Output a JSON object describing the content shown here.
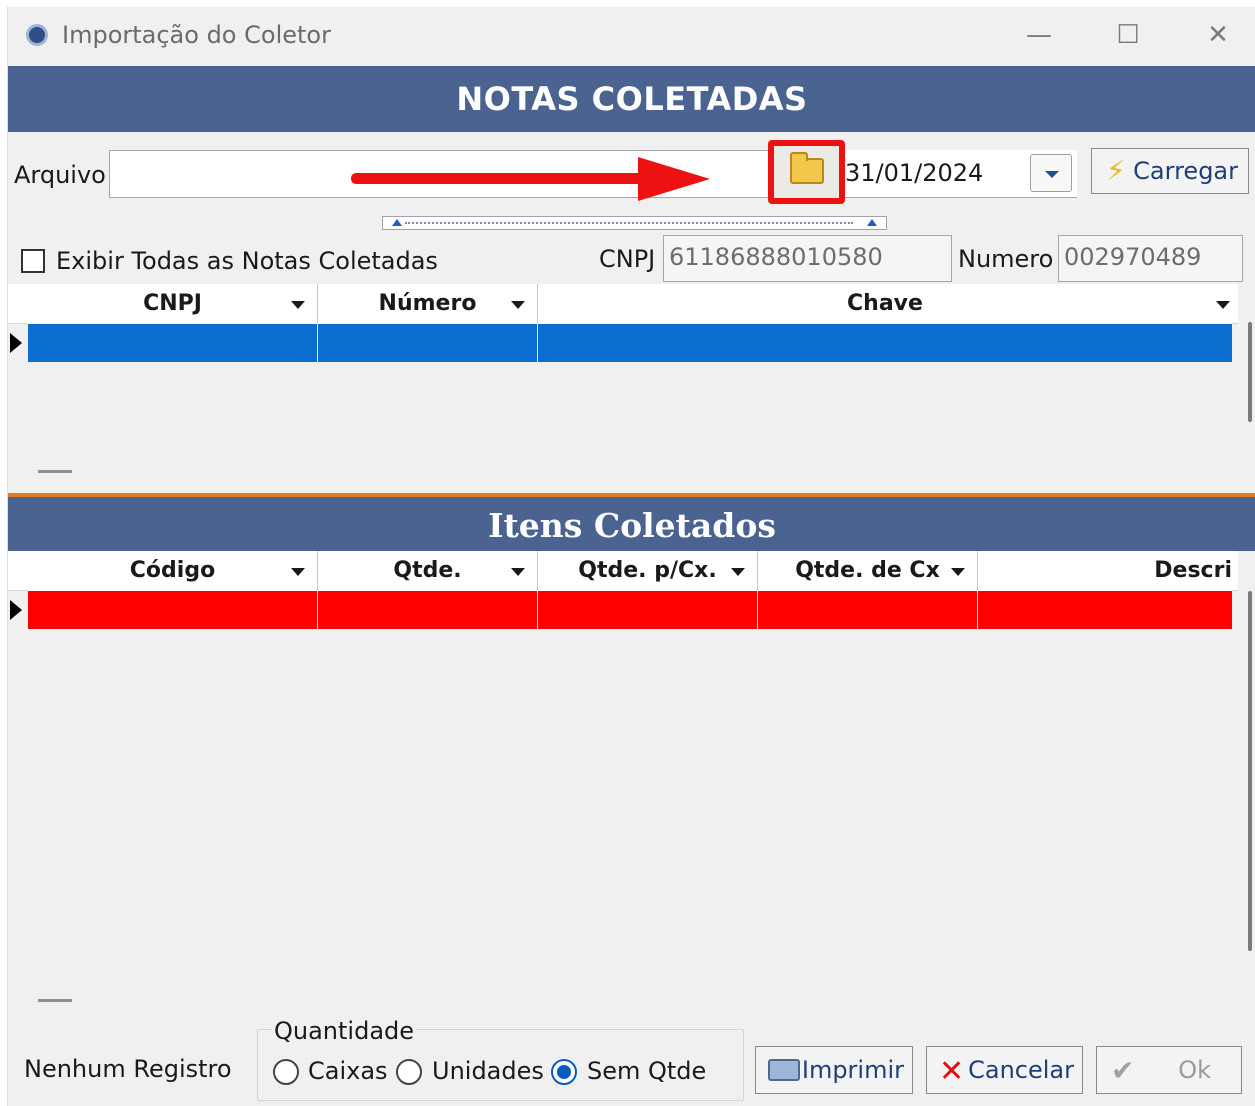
{
  "window": {
    "title": "Importação do Coletor",
    "controls": {
      "minimize": "—",
      "maximize": "☐",
      "close": "✕"
    }
  },
  "notas": {
    "header": "NOTAS COLETADAS",
    "arquivo_label": "Arquivo",
    "arquivo_value": "",
    "date_value": "31/01/2024",
    "carregar_label": "Carregar",
    "exibir_label": "Exibir Todas as Notas Coletadas",
    "exibir_checked": false,
    "cnpj_label": "CNPJ",
    "cnpj_value": "61186888010580",
    "numero_label": "Numero",
    "numero_value": "002970489",
    "columns": [
      "CNPJ",
      "Número",
      "Chave"
    ],
    "rows": [
      [
        "",
        "",
        ""
      ]
    ]
  },
  "itens": {
    "header": "Itens Coletados",
    "columns": [
      "Código",
      "Qtde.",
      "Qtde. p/Cx.",
      "Qtde. de Cx",
      "Descri"
    ],
    "rows": [
      [
        "",
        "",
        "",
        "",
        ""
      ]
    ]
  },
  "footer": {
    "status": "Nenhum Registro",
    "quantidade_legend": "Quantidade",
    "options": [
      "Caixas",
      "Unidades",
      "Sem Qtde"
    ],
    "selected_option": "Sem Qtde",
    "imprimir_label": "Imprimir",
    "cancelar_label": "Cancelar",
    "ok_label": "Ok"
  },
  "colors": {
    "header_band": "#4b6390",
    "selected_row_notas": "#0a6ed1",
    "selected_row_itens": "#ff0000",
    "annotation": "#ee1111"
  }
}
